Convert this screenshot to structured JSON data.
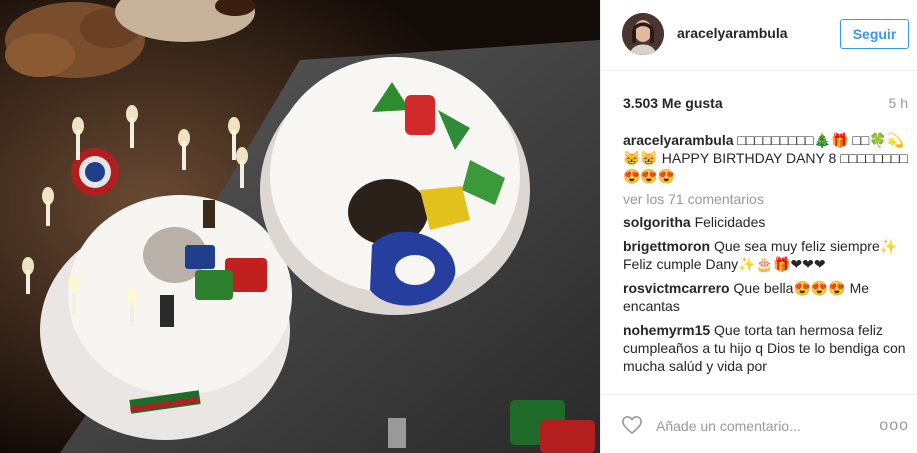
{
  "post": {
    "username": "aracelyarambula",
    "follow_label": "Seguir",
    "likes": "3.503 Me gusta",
    "time": "5 h",
    "view_comments": "ver los 71 comentarios",
    "add_comment_placeholder": "Añade un comentario...",
    "more_options": "ooo"
  },
  "comments": [
    {
      "user": "aracelyarambula",
      "text": "□□□□□□□□□🎄🎁 □□🍀💫😸😸 HAPPY BIRTHDAY DANY 8 □□□□□□□□😍😍😍"
    },
    {
      "user": "solgoritha",
      "text": "Felicidades"
    },
    {
      "user": "brigettmoron",
      "text": "Que sea muy feliz siempre✨ Feliz cumple Dany✨🎂🎁❤❤❤"
    },
    {
      "user": "rosvictmcarrero",
      "text": "Que bella😍😍😍 Me encantas"
    },
    {
      "user": "nohemyrm15",
      "text": "Que torta tan hermosa feliz cumpleaños a tu hijo q Dios te lo bendiga con mucha salúd y vida por"
    }
  ],
  "icons": {
    "heart": "heart-outline-icon",
    "more": "more-options-icon"
  },
  "colors": {
    "follow_blue": "#3897f0",
    "muted": "#999999",
    "text": "#262626"
  }
}
